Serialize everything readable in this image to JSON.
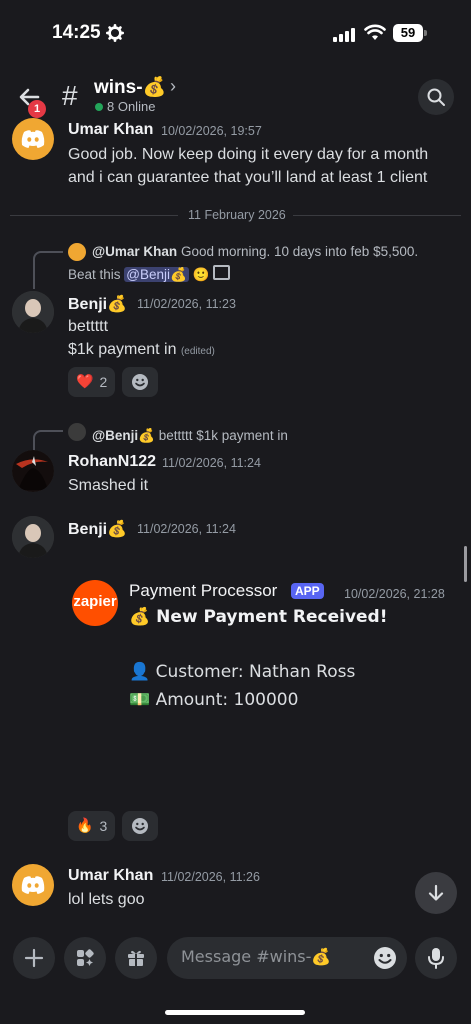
{
  "status_bar": {
    "time": "14:25",
    "battery": "59"
  },
  "header": {
    "back_badge": "1",
    "channel_name": "wins-💰",
    "online": "8 Online"
  },
  "messages": [
    {
      "author": "Umar Khan",
      "timestamp": "10/02/2026, 19:57",
      "lines": [
        "Good job. Now keep doing it every day for a month",
        "and i can guarantee that you’ll land at least 1 client"
      ]
    },
    {
      "date_divider": "11 February 2026"
    },
    {
      "reply": {
        "author": "@Umar Khan",
        "text": "Good morning. 10 days into feb $5,500.",
        "text2": "Beat this",
        "mention": "@Benji💰"
      },
      "author": "Benji💰",
      "timestamp": "11/02/2026, 11:23",
      "lines": [
        "bettttt",
        "$1k payment in"
      ],
      "edited": "(edited)",
      "reactions": [
        {
          "emoji": "❤️",
          "count": "2"
        }
      ]
    },
    {
      "reply": {
        "author": "@Benji💰",
        "text": "bettttt $1k payment in"
      },
      "author": "RohanN122",
      "timestamp": "11/02/2026, 11:24",
      "lines": [
        "Smashed it"
      ]
    },
    {
      "author": "Benji💰",
      "timestamp": "11/02/2026, 11:24",
      "embed": {
        "logo": "zapier",
        "author": "Payment Processor",
        "tag": "APP",
        "timestamp": "10/02/2026, 21:28",
        "title": "💰 New Payment Received!",
        "customer": "👤 Customer: Nathan Ross",
        "amount": "💵 Amount: 100000"
      },
      "reactions": [
        {
          "emoji": "🔥",
          "count": "3"
        }
      ]
    },
    {
      "author": "Umar Khan",
      "timestamp": "11/02/2026, 11:26",
      "lines": [
        "lol lets goo"
      ]
    }
  ],
  "composer": {
    "placeholder": "Message #wins-💰"
  },
  "colors": {
    "background": "#1a1a1e",
    "accent": "#5865f2",
    "online": "#23a55a",
    "badge": "#e53945"
  }
}
